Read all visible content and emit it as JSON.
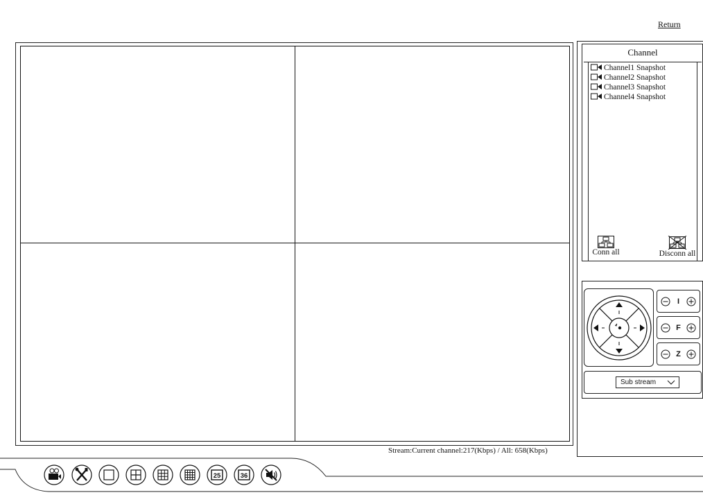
{
  "header": {
    "return_label": "Return"
  },
  "video": {
    "stream_status": "Stream:Current channel:217(Kbps) / All: 658(Kbps)"
  },
  "channel_panel": {
    "title": "Channel",
    "items": [
      {
        "label": "Channel1 Snapshot",
        "icon": "camera-icon"
      },
      {
        "label": "Channel2 Snapshot",
        "icon": "camera-icon"
      },
      {
        "label": "Channel3 Snapshot",
        "icon": "camera-icon"
      },
      {
        "label": "Channel4 Snapshot",
        "icon": "camera-icon"
      }
    ],
    "conn_all_label": "Conn all",
    "disconn_all_label": "Disconn all"
  },
  "ptz": {
    "iris_label": "I",
    "focus_label": "F",
    "zoom_label": "Z",
    "stream_select": {
      "value": "Sub stream"
    }
  },
  "toolbar": {
    "buttons": [
      {
        "name": "record-button",
        "icon": "camera-reel-icon"
      },
      {
        "name": "settings-button",
        "icon": "tools-icon"
      },
      {
        "name": "layout-1-button",
        "icon": "single-view-icon"
      },
      {
        "name": "layout-4-button",
        "icon": "grid-2x2-icon"
      },
      {
        "name": "layout-9-button",
        "icon": "grid-3x3-icon"
      },
      {
        "name": "layout-16-button",
        "icon": "grid-4x4-icon"
      },
      {
        "name": "layout-25-button",
        "label": "25"
      },
      {
        "name": "layout-36-button",
        "label": "36"
      },
      {
        "name": "mute-button",
        "icon": "mute-icon"
      }
    ]
  }
}
